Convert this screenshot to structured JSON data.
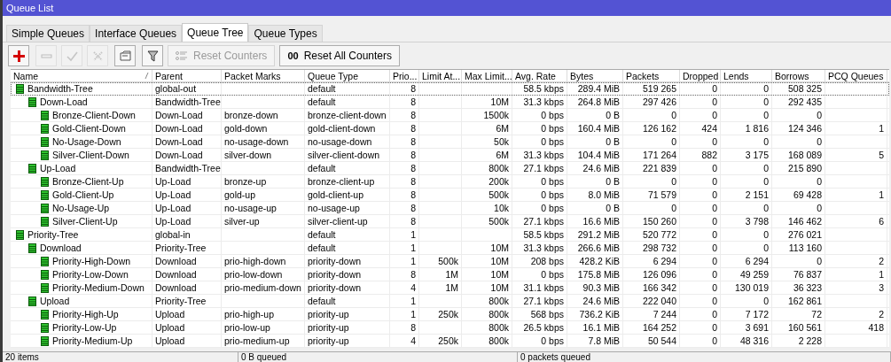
{
  "window": {
    "title": "Queue List"
  },
  "tabs": [
    {
      "label": "Simple Queues",
      "selected": false
    },
    {
      "label": "Interface Queues",
      "selected": false
    },
    {
      "label": "Queue Tree",
      "selected": true
    },
    {
      "label": "Queue Types",
      "selected": false
    }
  ],
  "toolbar": [
    {
      "kind": "add",
      "disabled": false
    },
    {
      "kind": "remove",
      "disabled": true
    },
    {
      "kind": "enable",
      "disabled": true
    },
    {
      "kind": "disable",
      "disabled": true
    },
    {
      "kind": "comment",
      "disabled": false
    },
    {
      "kind": "filter",
      "disabled": false
    },
    {
      "kind": "reset",
      "label": "Reset Counters",
      "disabled": true
    },
    {
      "kind": "reset-all",
      "label": "Reset All Counters",
      "icon_text": "00",
      "disabled": false
    }
  ],
  "table": {
    "columns": [
      {
        "label": "Name",
        "sorted": true
      },
      {
        "label": "Parent",
        "sorted": false
      },
      {
        "label": "Packet Marks",
        "sorted": false
      },
      {
        "label": "Queue Type",
        "sorted": false
      },
      {
        "label": "Prio...",
        "sorted": false
      },
      {
        "label": "Limit At...",
        "sorted": false
      },
      {
        "label": "Max Limit...",
        "sorted": false
      },
      {
        "label": "Avg. Rate",
        "sorted": false
      },
      {
        "label": "Bytes",
        "sorted": false
      },
      {
        "label": "Packets",
        "sorted": false
      },
      {
        "label": "Dropped",
        "sorted": false
      },
      {
        "label": "Lends",
        "sorted": false
      },
      {
        "label": "Borrows",
        "sorted": false
      },
      {
        "label": "PCQ Queues",
        "sorted": false
      }
    ],
    "rows": [
      {
        "name": "Bandwidth-Tree",
        "parent": "global-out",
        "queue_type": "default",
        "priority": "8",
        "avg_rate": "58.5 kbps",
        "bytes": "289.4 MiB",
        "packets": "519 265",
        "dropped": "0",
        "lends": "0",
        "borrows": "508 325",
        "focused": true,
        "children": [
          {
            "name": "Down-Load",
            "parent": "Bandwidth-Tree",
            "queue_type": "default",
            "priority": "8",
            "max_limit": "10M",
            "avg_rate": "31.3 kbps",
            "bytes": "264.8 MiB",
            "packets": "297 426",
            "dropped": "0",
            "lends": "0",
            "borrows": "292 435",
            "focused": false,
            "children": [
              {
                "name": "Bronze-Client-Down",
                "parent": "Down-Load",
                "packet_marks": "bronze-down",
                "queue_type": "bronze-client-down",
                "priority": "8",
                "max_limit": "1500k",
                "avg_rate": "0 bps",
                "bytes": "0 B",
                "packets": "0",
                "dropped": "0",
                "lends": "0",
                "borrows": "0",
                "focused": false
              },
              {
                "name": "Gold-Client-Down",
                "parent": "Down-Load",
                "packet_marks": "gold-down",
                "queue_type": "gold-client-down",
                "priority": "8",
                "max_limit": "6M",
                "avg_rate": "0 bps",
                "bytes": "160.4 MiB",
                "packets": "126 162",
                "dropped": "424",
                "lends": "1 816",
                "borrows": "124 346",
                "pcq_queues": "1",
                "focused": false
              },
              {
                "name": "No-Usage-Down",
                "parent": "Down-Load",
                "packet_marks": "no-usage-down",
                "queue_type": "no-usage-down",
                "priority": "8",
                "max_limit": "50k",
                "avg_rate": "0 bps",
                "bytes": "0 B",
                "packets": "0",
                "dropped": "0",
                "lends": "0",
                "borrows": "0",
                "focused": false
              },
              {
                "name": "Silver-Client-Down",
                "parent": "Down-Load",
                "packet_marks": "silver-down",
                "queue_type": "silver-client-down",
                "priority": "8",
                "max_limit": "6M",
                "avg_rate": "31.3 kbps",
                "bytes": "104.4 MiB",
                "packets": "171 264",
                "dropped": "882",
                "lends": "3 175",
                "borrows": "168 089",
                "pcq_queues": "5",
                "focused": false
              }
            ]
          },
          {
            "name": "Up-Load",
            "parent": "Bandwidth-Tree",
            "queue_type": "default",
            "priority": "8",
            "max_limit": "800k",
            "avg_rate": "27.1 kbps",
            "bytes": "24.6 MiB",
            "packets": "221 839",
            "dropped": "0",
            "lends": "0",
            "borrows": "215 890",
            "focused": false,
            "children": [
              {
                "name": "Bronze-Client-Up",
                "parent": "Up-Load",
                "packet_marks": "bronze-up",
                "queue_type": "bronze-client-up",
                "priority": "8",
                "max_limit": "200k",
                "avg_rate": "0 bps",
                "bytes": "0 B",
                "packets": "0",
                "dropped": "0",
                "lends": "0",
                "borrows": "0",
                "focused": false
              },
              {
                "name": "Gold-Client-Up",
                "parent": "Up-Load",
                "packet_marks": "gold-up",
                "queue_type": "gold-client-up",
                "priority": "8",
                "max_limit": "500k",
                "avg_rate": "0 bps",
                "bytes": "8.0 MiB",
                "packets": "71 579",
                "dropped": "0",
                "lends": "2 151",
                "borrows": "69 428",
                "pcq_queues": "1",
                "focused": false
              },
              {
                "name": "No-Usage-Up",
                "parent": "Up-Load",
                "packet_marks": "no-usage-up",
                "queue_type": "no-usage-up",
                "priority": "8",
                "max_limit": "10k",
                "avg_rate": "0 bps",
                "bytes": "0 B",
                "packets": "0",
                "dropped": "0",
                "lends": "0",
                "borrows": "0",
                "focused": false
              },
              {
                "name": "Silver-Client-Up",
                "parent": "Up-Load",
                "packet_marks": "silver-up",
                "queue_type": "silver-client-up",
                "priority": "8",
                "max_limit": "500k",
                "avg_rate": "27.1 kbps",
                "bytes": "16.6 MiB",
                "packets": "150 260",
                "dropped": "0",
                "lends": "3 798",
                "borrows": "146 462",
                "pcq_queues": "6",
                "focused": false
              }
            ]
          }
        ]
      },
      {
        "name": "Priority-Tree",
        "parent": "global-in",
        "queue_type": "default",
        "priority": "1",
        "avg_rate": "58.5 kbps",
        "bytes": "291.2 MiB",
        "packets": "520 772",
        "dropped": "0",
        "lends": "0",
        "borrows": "276 021",
        "focused": false,
        "children": [
          {
            "name": "Download",
            "parent": "Priority-Tree",
            "queue_type": "default",
            "priority": "1",
            "max_limit": "10M",
            "avg_rate": "31.3 kbps",
            "bytes": "266.6 MiB",
            "packets": "298 732",
            "dropped": "0",
            "lends": "0",
            "borrows": "113 160",
            "focused": false,
            "children": [
              {
                "name": "Priority-High-Down",
                "parent": "Download",
                "packet_marks": "prio-high-down",
                "queue_type": "priority-down",
                "priority": "1",
                "limit_at": "500k",
                "max_limit": "10M",
                "avg_rate": "208 bps",
                "bytes": "428.2 KiB",
                "packets": "6 294",
                "dropped": "0",
                "lends": "6 294",
                "borrows": "0",
                "pcq_queues": "2",
                "focused": false
              },
              {
                "name": "Priority-Low-Down",
                "parent": "Download",
                "packet_marks": "prio-low-down",
                "queue_type": "priority-down",
                "priority": "8",
                "limit_at": "1M",
                "max_limit": "10M",
                "avg_rate": "0 bps",
                "bytes": "175.8 MiB",
                "packets": "126 096",
                "dropped": "0",
                "lends": "49 259",
                "borrows": "76 837",
                "pcq_queues": "1",
                "focused": false
              },
              {
                "name": "Priority-Medium-Down",
                "parent": "Download",
                "packet_marks": "prio-medium-down",
                "queue_type": "priority-down",
                "priority": "4",
                "limit_at": "1M",
                "max_limit": "10M",
                "avg_rate": "31.1 kbps",
                "bytes": "90.3 MiB",
                "packets": "166 342",
                "dropped": "0",
                "lends": "130 019",
                "borrows": "36 323",
                "pcq_queues": "3",
                "focused": false
              }
            ]
          },
          {
            "name": "Upload",
            "parent": "Priority-Tree",
            "queue_type": "default",
            "priority": "1",
            "max_limit": "800k",
            "avg_rate": "27.1 kbps",
            "bytes": "24.6 MiB",
            "packets": "222 040",
            "dropped": "0",
            "lends": "0",
            "borrows": "162 861",
            "focused": false,
            "children": [
              {
                "name": "Priority-High-Up",
                "parent": "Upload",
                "packet_marks": "prio-high-up",
                "queue_type": "priority-up",
                "priority": "1",
                "limit_at": "250k",
                "max_limit": "800k",
                "avg_rate": "568 bps",
                "bytes": "736.2 KiB",
                "packets": "7 244",
                "dropped": "0",
                "lends": "7 172",
                "borrows": "72",
                "pcq_queues": "2",
                "focused": false
              },
              {
                "name": "Priority-Low-Up",
                "parent": "Upload",
                "packet_marks": "prio-low-up",
                "queue_type": "priority-up",
                "priority": "8",
                "max_limit": "800k",
                "avg_rate": "26.5 kbps",
                "bytes": "16.1 MiB",
                "packets": "164 252",
                "dropped": "0",
                "lends": "3 691",
                "borrows": "160 561",
                "pcq_queues": "418",
                "focused": false
              },
              {
                "name": "Priority-Medium-Up",
                "parent": "Upload",
                "packet_marks": "prio-medium-up",
                "queue_type": "priority-up",
                "priority": "4",
                "limit_at": "250k",
                "max_limit": "800k",
                "avg_rate": "0 bps",
                "bytes": "7.8 MiB",
                "packets": "50 544",
                "dropped": "0",
                "lends": "48 316",
                "borrows": "2 228",
                "focused": false
              }
            ]
          }
        ]
      }
    ]
  },
  "status_bar": [
    "20 items",
    "0 B queued",
    "0 packets queued"
  ]
}
